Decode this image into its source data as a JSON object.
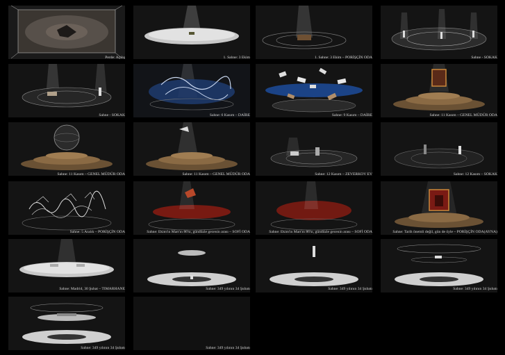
{
  "panels": [
    {
      "caption": "Perde: Açılış",
      "scene": "curtain"
    },
    {
      "caption": "1. Sahne: 3 Ekim",
      "scene": "disc-light"
    },
    {
      "caption": "1. Sahne: 3 Ekim – PORİŞÇİN ODA",
      "scene": "ring-room"
    },
    {
      "caption": "Sahne - SOKAK",
      "scene": "street-figures"
    },
    {
      "caption": "Sahne - SOKAK",
      "scene": "street-ring"
    },
    {
      "caption": "Sahne: 6 Kasım – DAİRE",
      "scene": "blue-chaos"
    },
    {
      "caption": "Sahne: 9 Kasım – DAİRE",
      "scene": "flying-papers"
    },
    {
      "caption": "Sahne: 11 Kasım – GENEL MÜDÜR ODA",
      "scene": "steps-portrait"
    },
    {
      "caption": "Sahne: 11 Kasım – GENEL MÜDÜR ODA",
      "scene": "steps-globe"
    },
    {
      "caption": "Sahne: 11 Kasım – GENEL MÜDÜR ODA",
      "scene": "steps-light"
    },
    {
      "caption": "Sahne: 12 Kasım – ZEVERKOV EV",
      "scene": "dark-ring"
    },
    {
      "caption": "Sahne: 12 Kasım – SOKAK",
      "scene": "dark-street"
    },
    {
      "caption": "Sahne: 5 Aralık – PORİŞÇİN ODA",
      "scene": "scribble"
    },
    {
      "caption": "Sahne: Ekim'in Mart'ın 86'sı, gündüzle gecenin arası – SOFİ ODA",
      "scene": "red-glow"
    },
    {
      "caption": "Sahne: Ekim'in Mart'ın 86'sı, gündüzle gecenin arası – SOFİ ODA",
      "scene": "red-glow-2"
    },
    {
      "caption": "Sahne: Tarih önemli değil, gün de öyle – PORİŞÇİN ODA(AYNA)",
      "scene": "red-throne"
    },
    {
      "caption": "Sahne: Madrid, 30 Şubat – TIMARHANE",
      "scene": "asylum"
    },
    {
      "caption": "Sahne: 349 yılının 34 Şubatı",
      "scene": "hover-disc"
    },
    {
      "caption": "Sahne: 349 yılının 34 Şubatı",
      "scene": "hover-disc-2"
    },
    {
      "caption": "Sahne: 349 yılının 34 Şubatı",
      "scene": "hover-disc-3"
    },
    {
      "caption": "Sahne: 349 yılının 34 Şubatı",
      "scene": "final-1"
    },
    {
      "caption": "Sahne: 349 yılının 34 Şubatı",
      "scene": "final-2"
    }
  ]
}
